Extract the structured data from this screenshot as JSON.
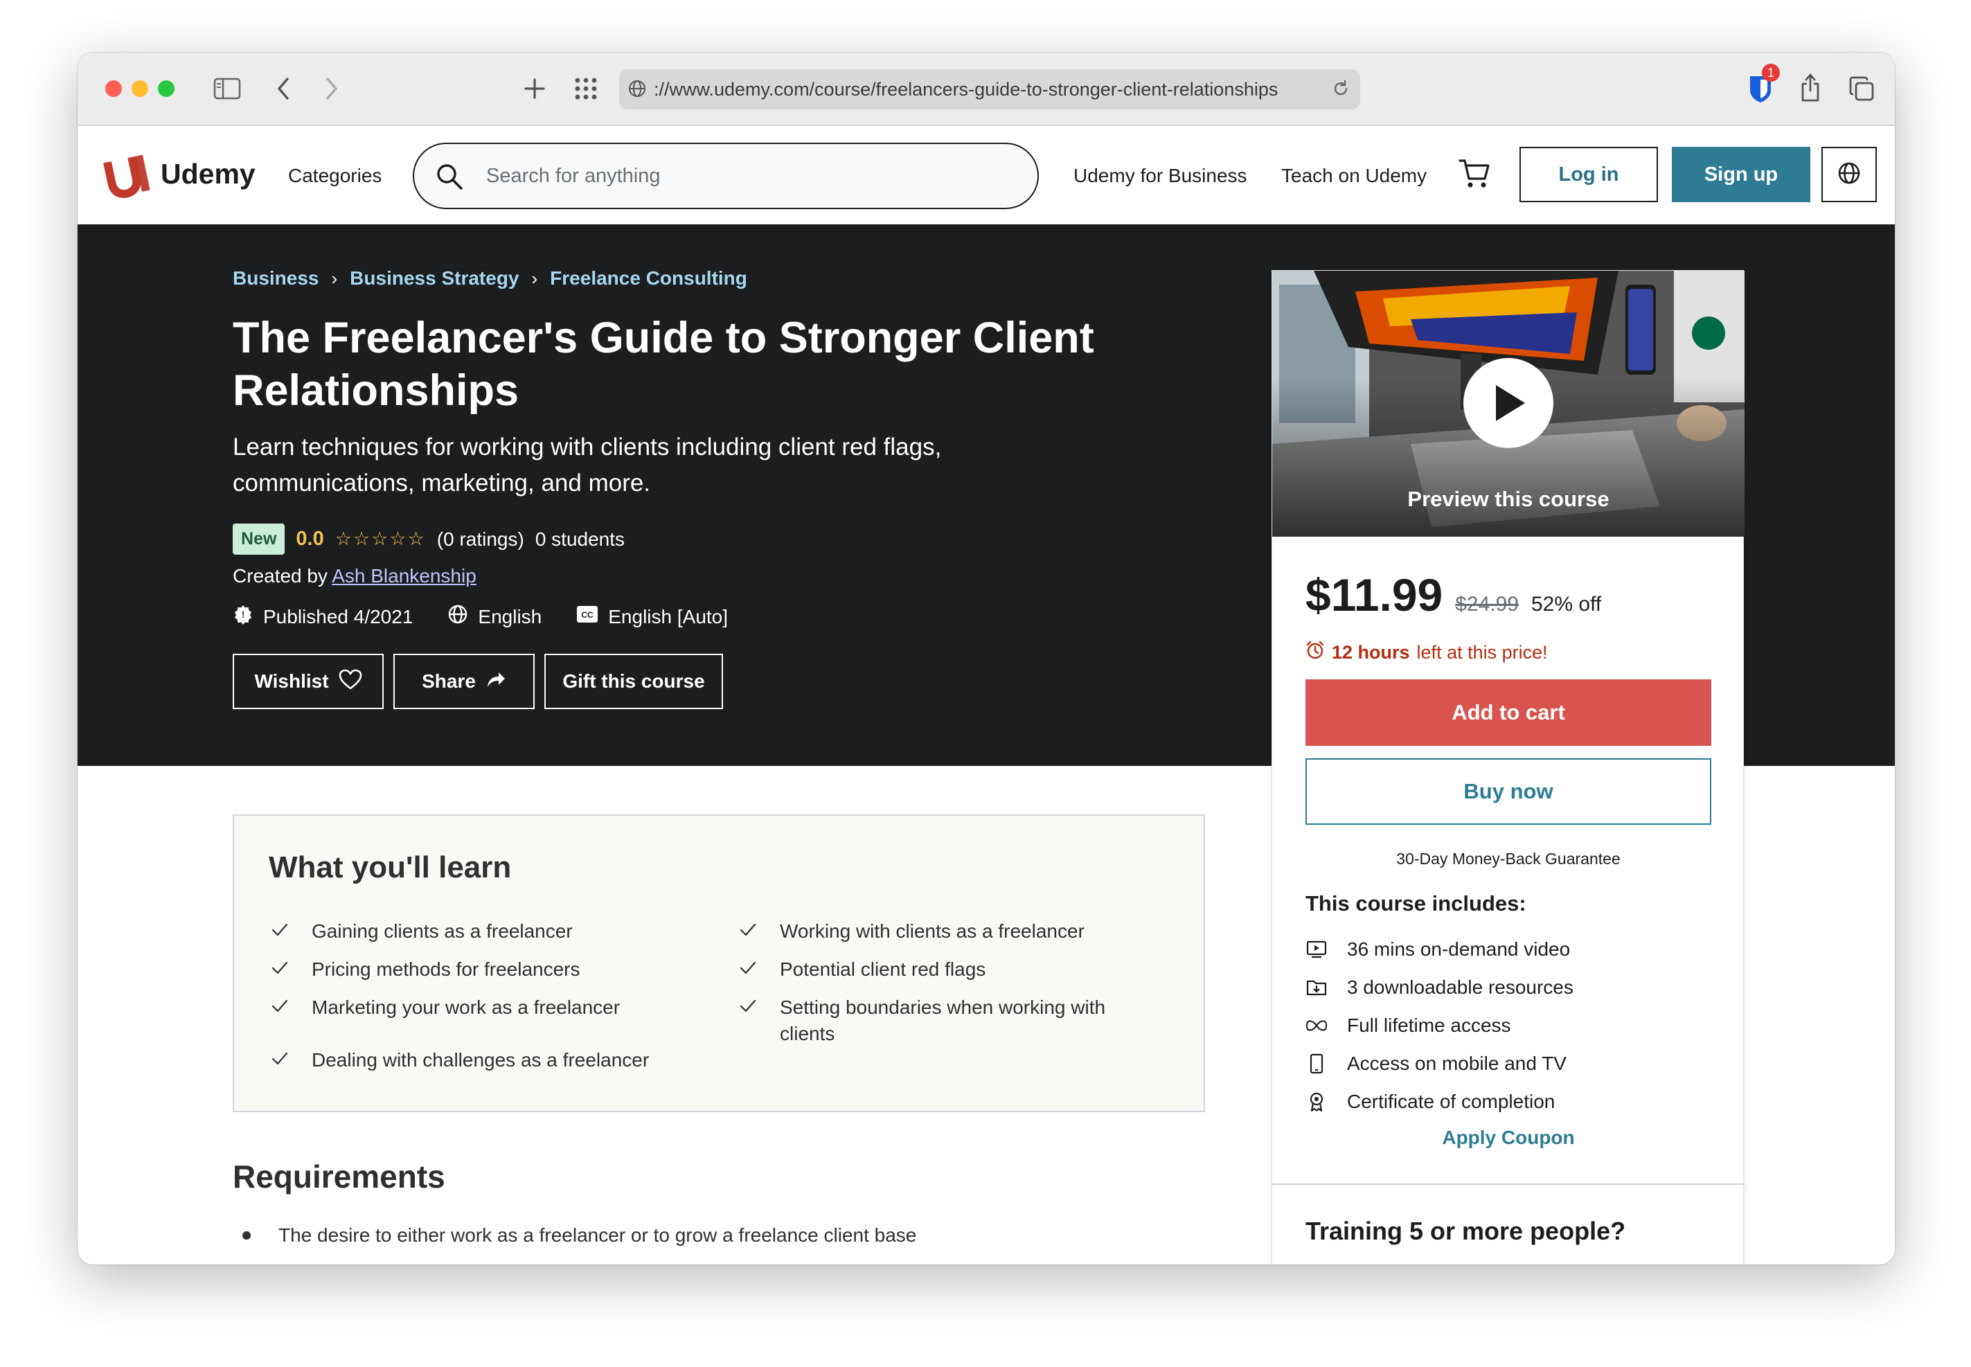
{
  "browser": {
    "url": "://www.udemy.com/course/freelancers-guide-to-stronger-client-relationships",
    "extension_badge": "1"
  },
  "header": {
    "logo": "Udemy",
    "categories": "Categories",
    "search_placeholder": "Search for anything",
    "business_link": "Udemy for Business",
    "teach_link": "Teach on Udemy",
    "login": "Log in",
    "signup": "Sign up"
  },
  "breadcrumbs": [
    "Business",
    "Business Strategy",
    "Freelance Consulting"
  ],
  "course": {
    "title": "The Freelancer's Guide to Stronger Client Relationships",
    "subtitle": "Learn techniques for working with clients including client red flags, communications, marketing, and more.",
    "badge": "New",
    "rating": "0.0",
    "rating_value": 0,
    "stars": "☆☆☆☆☆",
    "ratings_count": "(0 ratings)",
    "students": "0 students",
    "created_by_label": "Created by",
    "author": "Ash Blankenship",
    "published": "Published 4/2021",
    "language": "English",
    "captions": "English [Auto]"
  },
  "actions": {
    "wishlist": "Wishlist",
    "share": "Share",
    "gift": "Gift this course"
  },
  "sidebar": {
    "preview_label": "Preview this course",
    "price": "$11.99",
    "original_price": "$24.99",
    "discount": "52% off",
    "urgency_bold": "12 hours",
    "urgency_rest": "left at this price!",
    "add_to_cart": "Add to cart",
    "buy_now": "Buy now",
    "guarantee": "30-Day Money-Back Guarantee",
    "includes_title": "This course includes:",
    "includes": [
      {
        "icon": "video-icon",
        "label": "36 mins on-demand video"
      },
      {
        "icon": "download-icon",
        "label": "3 downloadable resources"
      },
      {
        "icon": "infinity-icon",
        "label": "Full lifetime access"
      },
      {
        "icon": "mobile-icon",
        "label": "Access on mobile and TV"
      },
      {
        "icon": "certificate-icon",
        "label": "Certificate of completion"
      }
    ],
    "coupon": "Apply Coupon",
    "training": "Training 5 or more people?"
  },
  "learn": {
    "title": "What you'll learn",
    "items": [
      "Gaining clients as a freelancer",
      "Working with clients as a freelancer",
      "Pricing methods for freelancers",
      "Potential client red flags",
      "Marketing your work as a freelancer",
      "Setting boundaries when working with clients",
      "Dealing with challenges as a freelancer"
    ]
  },
  "requirements": {
    "title": "Requirements",
    "items": [
      "The desire to either work as a freelancer or to grow a freelance client base"
    ]
  },
  "colors": {
    "accent_purple": "#a435f0",
    "brand_teal": "#2e7c94",
    "cart_red": "#d9544f",
    "star_gold": "#f4c150",
    "hero_dark": "#1c1d1f"
  }
}
